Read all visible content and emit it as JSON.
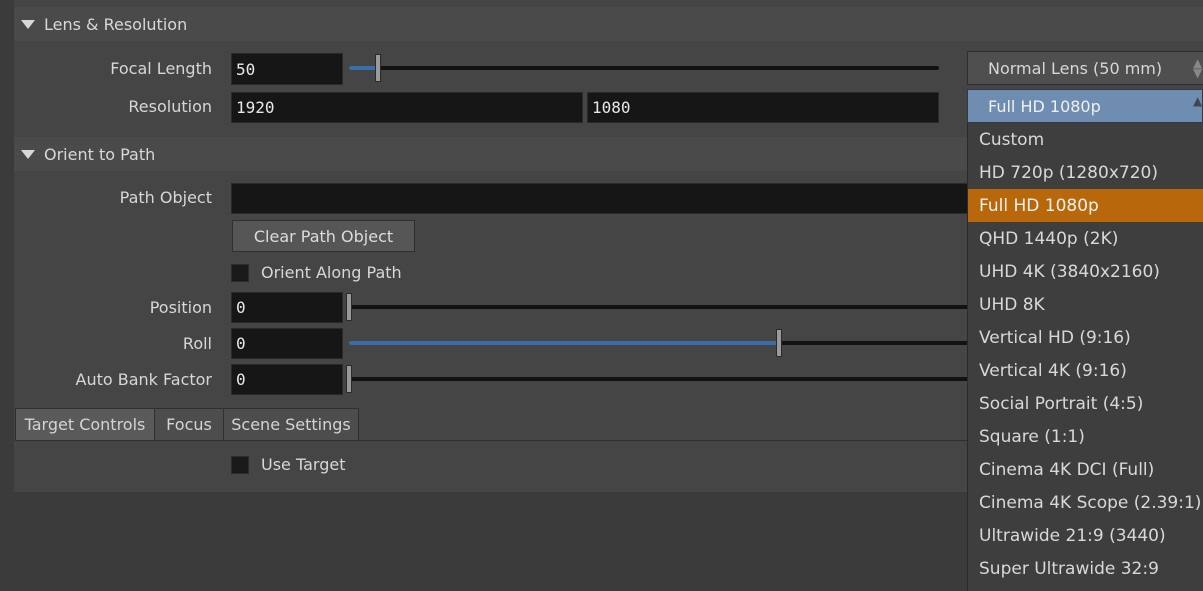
{
  "lens_section": {
    "title": "Lens & Resolution",
    "focal_length_label": "Focal Length",
    "focal_length_value": "50",
    "focal_length_slider": 0.05,
    "lens_preset": "Normal Lens (50 mm)",
    "resolution_label": "Resolution",
    "resolution_width": "1920",
    "resolution_height": "1080",
    "resolution_preset": "Full HD 1080p"
  },
  "orient_section": {
    "title": "Orient to Path",
    "path_object_label": "Path Object",
    "path_object_value": "",
    "clear_button": "Clear Path Object",
    "orient_along_label": "Orient Along Path",
    "position_label": "Position",
    "position_value": "0",
    "roll_label": "Roll",
    "roll_value": "0",
    "roll_slider": 0.5,
    "auto_bank_label": "Auto Bank Factor",
    "auto_bank_value": "0"
  },
  "tabs": [
    "Target Controls",
    "Focus",
    "Scene Settings"
  ],
  "target_tab": {
    "use_target_label": "Use Target"
  },
  "resolution_menu": {
    "items": [
      "Custom",
      "HD 720p (1280x720)",
      "Full HD 1080p",
      "QHD 1440p (2K)",
      "UHD 4K (3840x2160)",
      "UHD 8K",
      "Vertical HD (9:16)",
      "Vertical 4K (9:16)",
      "Social Portrait (4:5)",
      "Square (1:1)",
      "Cinema 4K DCI (Full)",
      "Cinema 4K Scope (2.39:1)",
      "Ultrawide 21:9 (3440)",
      "Super Ultrawide 32:9"
    ],
    "selected": "Full HD 1080p"
  },
  "colors": {
    "accent": "#b8680b",
    "slider_fill": "#3a6ea8"
  }
}
